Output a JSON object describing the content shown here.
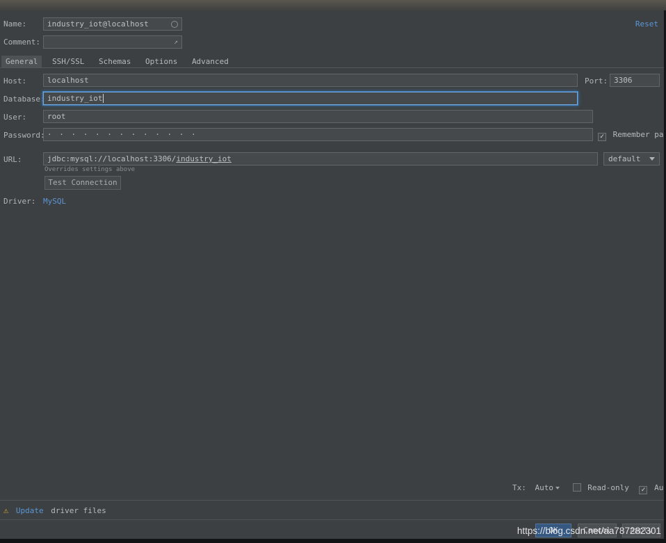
{
  "header": {
    "name_label": "Name:",
    "name_value": "industry_iot@localhost",
    "comment_label": "Comment:",
    "comment_value": "",
    "reset_label": "Reset"
  },
  "tabs": {
    "items": [
      {
        "label": "General",
        "selected": true
      },
      {
        "label": "SSH/SSL",
        "selected": false
      },
      {
        "label": "Schemas",
        "selected": false
      },
      {
        "label": "Options",
        "selected": false
      },
      {
        "label": "Advanced",
        "selected": false
      }
    ]
  },
  "form": {
    "host_label": "Host:",
    "host_value": "localhost",
    "port_label": "Port:",
    "port_value": "3306",
    "database_label": "Database:",
    "database_value": "industry_iot",
    "user_label": "User:",
    "user_value": "root",
    "password_label": "Password:",
    "password_masked": "· · · · · · · · · · · · ·",
    "remember_password_label": "Remember password",
    "remember_password_checked": true,
    "url_label": "URL:",
    "url_prefix": "jdbc:mysql://localhost:3306/",
    "url_database_link": "industry_iot",
    "url_note": "Overrides settings above",
    "url_profile_value": "default",
    "test_connection_label": "Test Connection",
    "driver_label": "Driver:",
    "driver_value": "MySQL"
  },
  "status": {
    "tx_label": "Tx:",
    "tx_value": "Auto",
    "read_only_label": "Read-only",
    "read_only_checked": false,
    "auto_sync_label": "Auto sync",
    "auto_sync_checked": true
  },
  "warning": {
    "link_label": "Update",
    "text": "driver files"
  },
  "buttons": {
    "ok": "OK",
    "cancel": "Cancel",
    "apply": "Apply"
  },
  "watermark": "https://blog.csdn.net/aa787282301",
  "misc": {
    "check_glyph": "✓",
    "expand_glyph": "↗"
  },
  "colors": {
    "panel_bg": "#3c4042",
    "field_bg": "#45494b",
    "accent_link": "#5b96d5",
    "focus_border": "#3e7fc1",
    "warning_yellow": "#e0a432",
    "ok_button_bg": "#365880",
    "watermark_text": "#ffffff"
  }
}
